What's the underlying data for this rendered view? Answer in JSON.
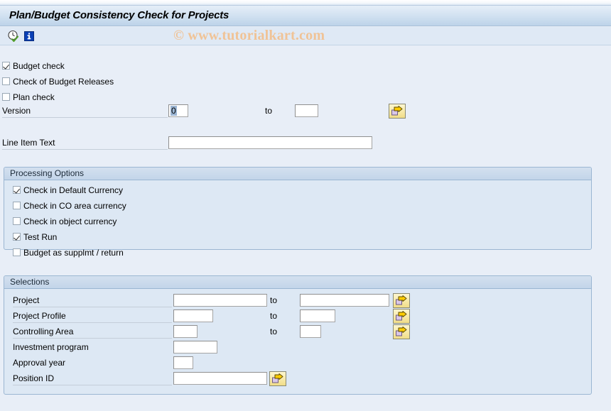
{
  "window": {
    "title": "Plan/Budget Consistency Check for Projects"
  },
  "toolbar": {
    "execute_icon": "execute-clock-check-icon",
    "info_icon": "information-icon"
  },
  "watermark": {
    "text": "© www.tutorialkart.com",
    "color": "#f0c396"
  },
  "main": {
    "checkboxes": [
      {
        "label": "Budget check",
        "checked": true
      },
      {
        "label": "Check of Budget Releases",
        "checked": false
      },
      {
        "label": "Plan check",
        "checked": false
      }
    ],
    "version_row": {
      "label": "Version",
      "value": "0",
      "to_label": "to",
      "to_value": "",
      "multi_select_icon": "multiple-selection-arrow-icon"
    },
    "line_item_text": {
      "label": "Line Item Text",
      "value": ""
    }
  },
  "processing_options": {
    "title": "Processing Options",
    "checkboxes": [
      {
        "label": "Check in Default Currency",
        "checked": true
      },
      {
        "label": "Check in CO area currency",
        "checked": false
      },
      {
        "label": "Check in object currency",
        "checked": false
      },
      {
        "label": "Test Run",
        "checked": true
      },
      {
        "label": "Budget as supplmt / return",
        "checked": false
      }
    ]
  },
  "selections": {
    "title": "Selections",
    "to_label": "to",
    "rows": [
      {
        "label": "Project",
        "from": "",
        "to": "",
        "has_to": true,
        "has_button": true,
        "from_w": 132,
        "to_w": 132
      },
      {
        "label": "Project Profile",
        "from": "",
        "to": "",
        "has_to": true,
        "has_button": true,
        "from_w": 56,
        "to_w": 56
      },
      {
        "label": "Controlling Area",
        "from": "",
        "to": "",
        "has_to": true,
        "has_button": true,
        "from_w": 34,
        "to_w": 34
      },
      {
        "label": "Investment program",
        "from": "",
        "to": null,
        "has_to": false,
        "has_button": false,
        "from_w": 62,
        "to_w": 0
      },
      {
        "label": "Approval year",
        "from": "",
        "to": null,
        "has_to": false,
        "has_button": false,
        "from_w": 28,
        "to_w": 0
      },
      {
        "label": "Position ID",
        "from": "",
        "to": null,
        "has_to": false,
        "has_button": true,
        "from_w": 132,
        "to_w": 0
      }
    ]
  }
}
